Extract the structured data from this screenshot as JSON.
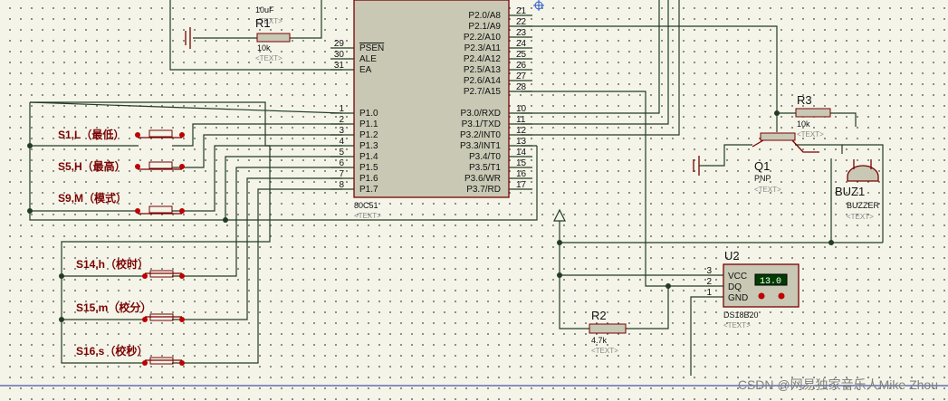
{
  "mcu": {
    "ref": "80C51",
    "text": "<TEXT>",
    "left_pins": [
      {
        "num": "29",
        "name": "PSEN"
      },
      {
        "num": "30",
        "name": "ALE"
      },
      {
        "num": "31",
        "name": "EA"
      },
      {
        "num": "1",
        "name": "P1.0"
      },
      {
        "num": "2",
        "name": "P1.1"
      },
      {
        "num": "3",
        "name": "P1.2"
      },
      {
        "num": "4",
        "name": "P1.3"
      },
      {
        "num": "5",
        "name": "P1.4"
      },
      {
        "num": "6",
        "name": "P1.5"
      },
      {
        "num": "7",
        "name": "P1.6"
      },
      {
        "num": "8",
        "name": "P1.7"
      }
    ],
    "right_pins": [
      {
        "num": "21",
        "name": "P2.0/A8"
      },
      {
        "num": "22",
        "name": "P2.1/A9"
      },
      {
        "num": "23",
        "name": "P2.2/A10"
      },
      {
        "num": "24",
        "name": "P2.3/A11"
      },
      {
        "num": "25",
        "name": "P2.4/A12"
      },
      {
        "num": "26",
        "name": "P2.5/A13"
      },
      {
        "num": "27",
        "name": "P2.6/A14"
      },
      {
        "num": "28",
        "name": "P2.7/A15"
      },
      {
        "num": "10",
        "name": "P3.0/RXD"
      },
      {
        "num": "11",
        "name": "P3.1/TXD"
      },
      {
        "num": "12",
        "name": "P3.2/INT0"
      },
      {
        "num": "13",
        "name": "P3.3/INT1"
      },
      {
        "num": "14",
        "name": "P3.4/T0"
      },
      {
        "num": "15",
        "name": "P3.5/T1"
      },
      {
        "num": "16",
        "name": "P3.6/WR"
      },
      {
        "num": "17",
        "name": "P3.7/RD"
      }
    ]
  },
  "cap": {
    "value": "10uF",
    "text": "<TEXT>"
  },
  "r1": {
    "ref": "R1",
    "value": "10k",
    "text": "<TEXT>"
  },
  "r2": {
    "ref": "R2",
    "value": "4.7k",
    "text": "<TEXT>"
  },
  "r3": {
    "ref": "R3",
    "value": "10k",
    "text": "<TEXT>"
  },
  "q1": {
    "ref": "Q1",
    "type": "PNP",
    "text": "<TEXT>"
  },
  "buzzer": {
    "ref": "BUZ1",
    "type": "BUZZER",
    "text": "<TEXT>"
  },
  "u2": {
    "ref": "U2",
    "part": "DS18B20",
    "text": "<TEXT>",
    "display": "13.0",
    "pins": [
      {
        "num": "3",
        "name": "VCC"
      },
      {
        "num": "2",
        "name": "DQ"
      },
      {
        "num": "1",
        "name": "GND"
      }
    ]
  },
  "switches": [
    {
      "label": "S1,L（最低）"
    },
    {
      "label": "S5,H（最高）"
    },
    {
      "label": "S9,M（模式）"
    },
    {
      "label": "S14,h（校时）"
    },
    {
      "label": "S15,m（校分）"
    },
    {
      "label": "S16,s（校秒）"
    }
  ],
  "watermark": "CSDN @网易独家音乐人Mike Zhou"
}
